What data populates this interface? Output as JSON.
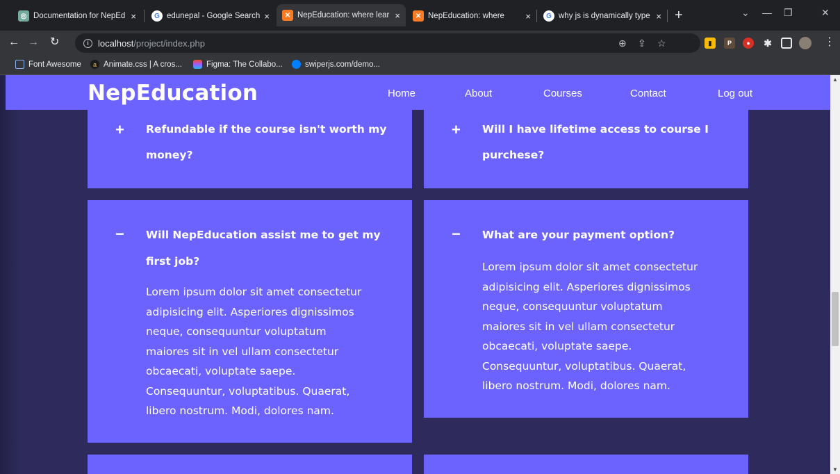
{
  "browser": {
    "tabs": [
      {
        "title": "Documentation for NepEd",
        "favicon": "chatgpt-icon",
        "favicon_color": "#74aa9c"
      },
      {
        "title": "edunepal - Google Search",
        "favicon": "google-icon",
        "favicon_color": "#ffffff"
      },
      {
        "title": "NepEducation: where lear",
        "favicon": "xampp-icon",
        "favicon_color": "#fb7a24"
      },
      {
        "title": "NepEducation: where",
        "favicon": "xampp-icon",
        "favicon_color": "#fb7a24"
      },
      {
        "title": "why js is dynamically type",
        "favicon": "google-icon",
        "favicon_color": "#ffffff"
      }
    ],
    "close_glyph": "×",
    "new_tab_glyph": "+",
    "url_host": "localhost",
    "url_path": "/project/index.php",
    "bookmarks": [
      {
        "label": "Font Awesome",
        "icon": "flag-icon"
      },
      {
        "label": "Animate.css | A cros...",
        "icon": "animate-icon"
      },
      {
        "label": "Figma: The Collabo...",
        "icon": "figma-icon"
      },
      {
        "label": "swiperjs.com/demo...",
        "icon": "swiper-icon"
      }
    ]
  },
  "site": {
    "logo": "NepEducation",
    "nav": [
      "Home",
      "About",
      "Courses",
      "Contact",
      "Log out"
    ],
    "accent": "#6c63ff",
    "background": "#2e2b5c"
  },
  "faq": {
    "collapsed_glyph": "+",
    "expanded_glyph": "−",
    "items": [
      {
        "q_line1": "Refundable if the course isn't worth my",
        "q_line2": "money?"
      },
      {
        "q_line1": "Will I have lifetime access to course I",
        "q_line2": "purchese?"
      },
      {
        "q_line1": "Will NepEducation assist me to get my",
        "q_line2": "first job?",
        "answer_lines": [
          "Lorem ipsum dolor sit amet consectetur",
          "adipisicing elit. Asperiores dignissimos",
          "neque, consequuntur voluptatum",
          "maiores sit in vel ullam consectetur",
          "obcaecati, voluptate saepe.",
          "Consequuntur, voluptatibus. Quaerat,",
          "libero nostrum. Modi, dolores nam."
        ]
      },
      {
        "q_line1": "What are your payment option?",
        "answer_lines": [
          "Lorem ipsum dolor sit amet consectetur",
          "adipisicing elit. Asperiores dignissimos",
          "neque, consequuntur voluptatum",
          "maiores sit in vel ullam consectetur",
          "obcaecati, voluptate saepe.",
          "Consequuntur, voluptatibus. Quaerat,",
          "libero nostrum. Modi, dolores nam."
        ]
      }
    ]
  }
}
